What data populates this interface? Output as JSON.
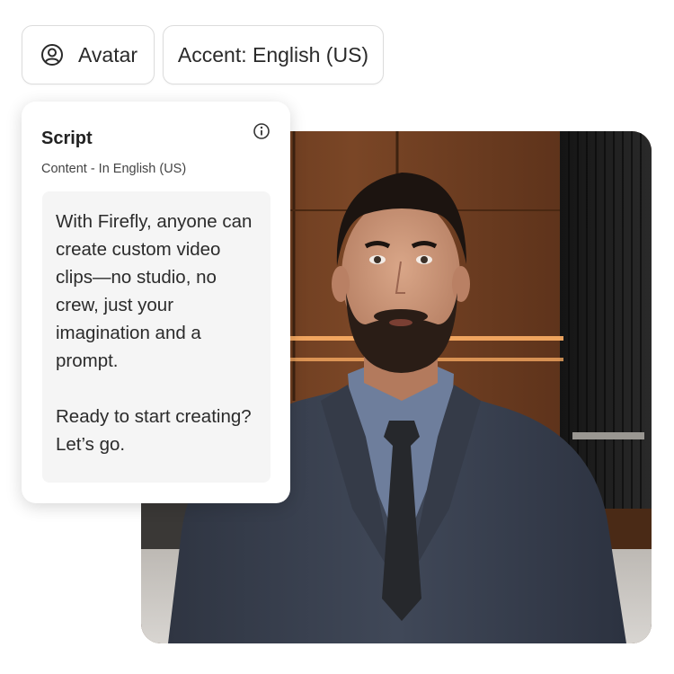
{
  "toolbar": {
    "avatar_chip": {
      "label": "Avatar",
      "icon": "user-circle-icon"
    },
    "accent_chip": {
      "label": "Accent: English (US)"
    }
  },
  "script_card": {
    "title": "Script",
    "subtitle": "Content - In English (US)",
    "info_icon": "info-icon",
    "text": "With Firefly, anyone can create custom video clips—no studio, no crew, just your imagination and a prompt.\n\nReady to start creating? Let’s go."
  },
  "colors": {
    "chip_border": "#dcdcdc",
    "script_box_bg": "#f5f5f5",
    "wood_panel": "#6a3c20",
    "suit": "#3a4150",
    "shirt": "#6e7e9c",
    "tie": "#26282c"
  }
}
